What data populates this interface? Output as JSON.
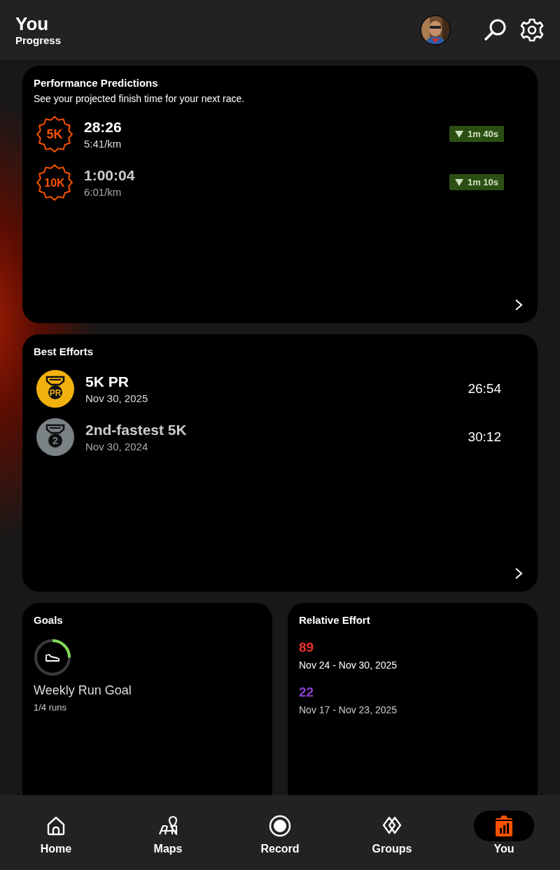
{
  "header": {
    "title": "You",
    "subtitle": "Progress"
  },
  "predictions": {
    "title": "Performance Predictions",
    "subtitle": "See your projected finish time for your next race.",
    "items": [
      {
        "badge": "5K",
        "time": "28:26",
        "pace": "5:41/km",
        "change": "1m 40s"
      },
      {
        "badge": "10K",
        "time": "1:00:04",
        "pace": "6:01/km",
        "change": "1m 10s"
      }
    ]
  },
  "best_efforts": {
    "title": "Best Efforts",
    "items": [
      {
        "kind": "pr",
        "medal": "PR",
        "title": "5K PR",
        "date": "Nov 30, 2025",
        "time": "26:54"
      },
      {
        "kind": "rank",
        "medal": "2",
        "title": "2nd-fastest 5K",
        "date": "Nov 30, 2024",
        "time": "30:12"
      }
    ]
  },
  "goals": {
    "title": "Goals",
    "name": "Weekly Run Goal",
    "progress": "1/4 runs",
    "level": 0.25
  },
  "relative_effort": {
    "title": "Relative Effort",
    "items": [
      {
        "score": "89",
        "color": "#e8322b",
        "range": "Nov 24 - Nov 30, 2025"
      },
      {
        "score": "22",
        "color": "#8c3fd0",
        "range": "Nov 17 - Nov 23, 2025"
      }
    ]
  },
  "nav": [
    {
      "label": "Home",
      "kind": "home",
      "selected": false
    },
    {
      "label": "Maps",
      "kind": "maps",
      "selected": false
    },
    {
      "label": "Record",
      "kind": "record",
      "selected": false
    },
    {
      "label": "Groups",
      "kind": "groups",
      "selected": false
    },
    {
      "label": "You",
      "kind": "you",
      "selected": true
    }
  ]
}
